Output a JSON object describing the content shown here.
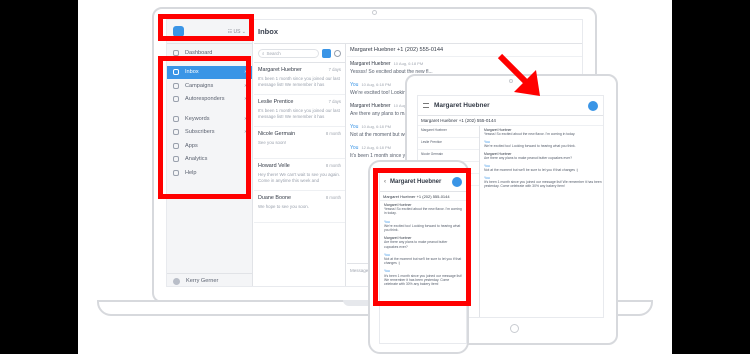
{
  "colors": {
    "accent": "#3a95e6",
    "highlight": "#ff0000"
  },
  "sidebar": {
    "account": "☷ US ⌄",
    "items": [
      {
        "label": "Dashboard",
        "icon": "dashboard-icon"
      },
      {
        "label": "Inbox",
        "icon": "inbox-icon",
        "active": true,
        "chevron": "›"
      },
      {
        "label": "Campaigns",
        "icon": "campaigns-icon",
        "chevron": "›"
      },
      {
        "label": "Autoresponders",
        "icon": "autoresponders-icon",
        "chevron": "›"
      },
      {
        "label": "Keywords",
        "icon": "keywords-icon",
        "chevron": "›"
      },
      {
        "label": "Subscribers",
        "icon": "subscribers-icon",
        "chevron": "›"
      },
      {
        "label": "Apps",
        "icon": "apps-icon"
      },
      {
        "label": "Analytics",
        "icon": "analytics-icon"
      },
      {
        "label": "Help",
        "icon": "help-icon"
      }
    ],
    "user": "Kerry Gerner"
  },
  "inbox": {
    "title": "Inbox",
    "search_placeholder": "Search",
    "conversations": [
      {
        "name": "Margaret Huebner",
        "date": "7 days",
        "preview": "It's been 1 month since you joined our last message list! We remember it has"
      },
      {
        "name": "Leslie Prentice",
        "date": "7 days",
        "preview": "It's been 1 month since you joined our last message list! We remember it has"
      },
      {
        "name": "Nicole Germain",
        "date": "8 month",
        "preview": "See you soon!"
      },
      {
        "name": "Howard Velle",
        "date": "8 month",
        "preview": "Hey there! We can't wait to see you again. Come in anytime this week and"
      },
      {
        "name": "Duane Boone",
        "date": "8 month",
        "preview": "We hope to see you soon."
      }
    ]
  },
  "thread": {
    "header": "Margaret Huebner +1 (202) 555-0144",
    "messages": [
      {
        "who": "Margaret Huebner",
        "time": "10 Aug, 6:18 PM",
        "text": "Yessss! So excited about the new fl...",
        "you": false
      },
      {
        "who": "You",
        "time": "10 Aug, 6:18 PM",
        "text": "We're excited too! Looking forward t",
        "you": true
      },
      {
        "who": "Margaret Huebner",
        "time": "10 Aug, 6:18 PM",
        "text": "Are there any plans to make peach",
        "you": false
      },
      {
        "who": "You",
        "time": "10 Aug, 6:18 PM",
        "text": "Not at the moment but we'll be sure",
        "you": true
      },
      {
        "who": "You",
        "time": "12 Aug, 6:18 PM",
        "text": "It's been 1 month since you joined",
        "you": true
      }
    ],
    "reply_placeholder": "Message"
  },
  "tablet": {
    "title": "Margaret Huebner",
    "sub": "Margaret Huebner +1 (202) 555-0144",
    "list": [
      "Margaret Huebner",
      "Leslie Prentice",
      "Nicole Germain",
      "Howard Velle",
      "Duane Boone"
    ],
    "messages": [
      {
        "who": "Margaret Huebner",
        "text": "Yessss! So excited about the new flavor. I'm coming in today.",
        "you": false
      },
      {
        "who": "You",
        "text": "We're excited too! Looking forward to hearing what you think.",
        "you": true
      },
      {
        "who": "Margaret Huebner",
        "text": "Are there any plans to make peanut butter cupcakes ever?",
        "you": false
      },
      {
        "who": "You",
        "text": "Not at the moment but we'll be sure to let you if that changes :)",
        "you": true
      },
      {
        "who": "You",
        "text": "It's been 1 month since you joined our message list! We remember it has been yesterday. Come celebrate with 30% any bakery item!",
        "you": true
      }
    ]
  },
  "phone": {
    "title": "Margaret Huebner",
    "back": "‹",
    "sub": "Margaret Huebner +1 (202) 555-0144",
    "messages": [
      {
        "who": "Margaret Huebner",
        "text": "Yessss! So excited about the new flavor. I'm coming in today.",
        "you": false
      },
      {
        "who": "You",
        "text": "We're excited too! Looking forward to hearing what you think.",
        "you": true
      },
      {
        "who": "Margaret Huebner",
        "text": "Are there any plans to make peanut butter cupcakes ever?",
        "you": false
      },
      {
        "who": "You",
        "text": "Not at the moment but we'll be sure to let you if that changes :)",
        "you": true
      },
      {
        "who": "You",
        "text": "It's been 1 month since you joined our message list! We remember it has been yesterday. Come celebrate with 30% any bakery item!",
        "you": true
      }
    ]
  }
}
